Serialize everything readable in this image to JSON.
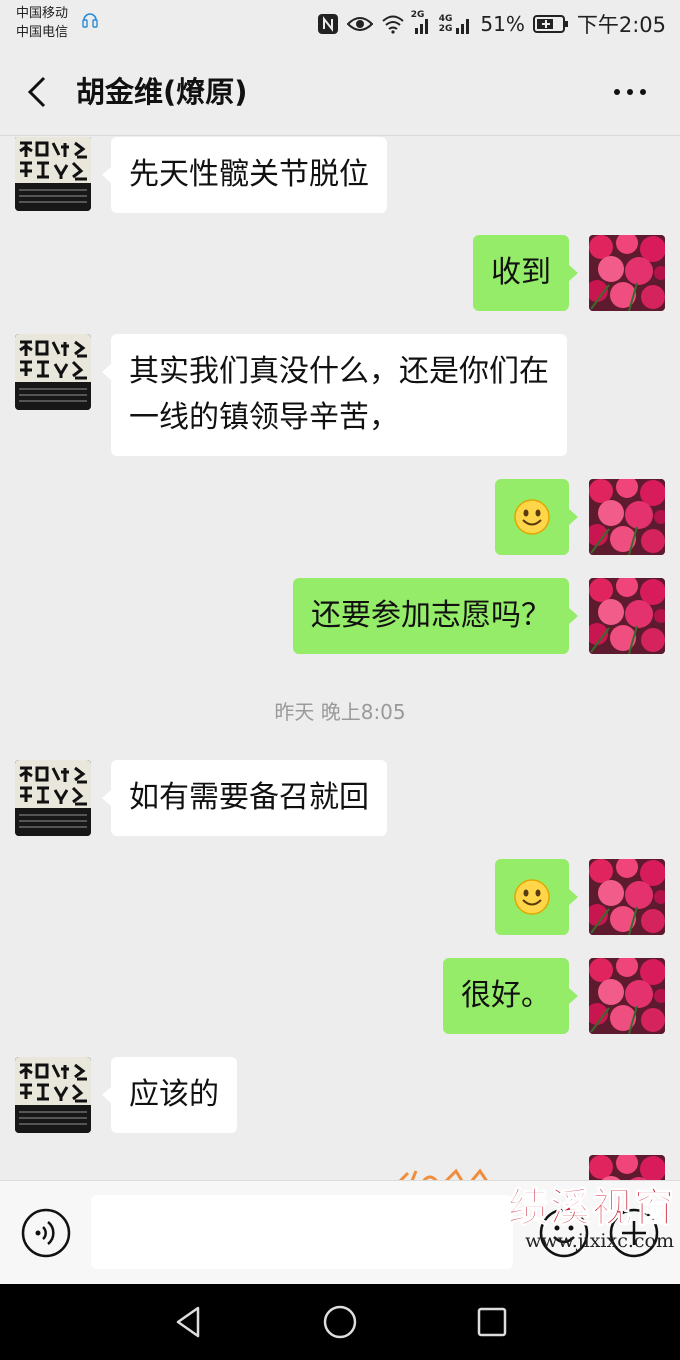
{
  "status_bar": {
    "carrier_1": "中国移动",
    "carrier_2": "中国电信",
    "net_a": "2G",
    "net_b_top": "4G",
    "net_b_bottom": "2G",
    "battery": "51%",
    "time": "下午2:05"
  },
  "nav": {
    "title": "胡金维(燎原)"
  },
  "messages": [
    {
      "side": "in",
      "avatar": "poster-avatar",
      "text": "先天性髋关节脱位"
    },
    {
      "side": "out",
      "avatar": "flower-avatar",
      "text": "收到"
    },
    {
      "side": "in",
      "avatar": "poster-avatar",
      "text": "其实我们真没什么，还是你们在\n一线的镇领导辛苦，"
    },
    {
      "side": "out",
      "avatar": "flower-avatar",
      "emoji": "smile-emoji"
    },
    {
      "side": "out",
      "avatar": "flower-avatar",
      "text": "还要参加志愿吗？"
    },
    {
      "side": "in",
      "avatar": "poster-avatar",
      "text": "如有需要备召就回"
    },
    {
      "side": "out",
      "avatar": "flower-avatar",
      "emoji": "smile-emoji"
    },
    {
      "side": "out",
      "avatar": "flower-avatar",
      "text": "很好。"
    },
    {
      "side": "in",
      "avatar": "poster-avatar",
      "text": "应该的"
    }
  ],
  "timestamp": "昨天 晚上8:05",
  "input": {
    "value": "",
    "placeholder": ""
  },
  "watermark": {
    "title": "绩溪视窗",
    "url": "www.jixixc.com"
  },
  "icons": {
    "voice": "voice-icon",
    "emoji": "emoji-icon",
    "plus": "plus-icon",
    "back": "back-icon",
    "more": "more-icon"
  },
  "colors": {
    "outgoing_bubble": "#95ec69",
    "incoming_bubble": "#ffffff",
    "background": "#ededed",
    "watermark": "#c8152b"
  }
}
